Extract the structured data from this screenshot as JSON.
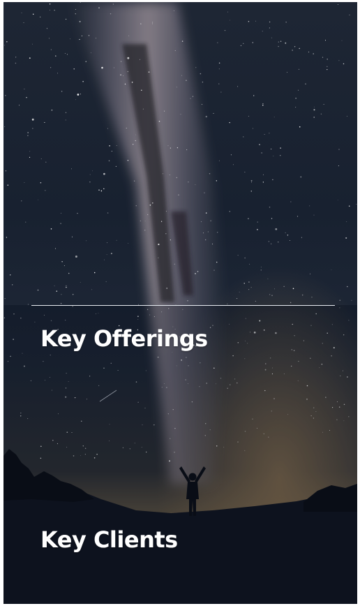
{
  "sections": {
    "offerings": {
      "title": "Key Offerings"
    },
    "clients": {
      "title": "Key Clients"
    }
  },
  "colors": {
    "sky_deep": "#0c1422",
    "milky_way": "#8a8494",
    "horizon_glow": "#8a7150",
    "ground": "#111826",
    "title_text": "#ffffff",
    "divider": "#e8ecf2"
  },
  "image": {
    "subject": "milky-way-night-sky",
    "foreground": "person-silhouette-arms-raised"
  }
}
